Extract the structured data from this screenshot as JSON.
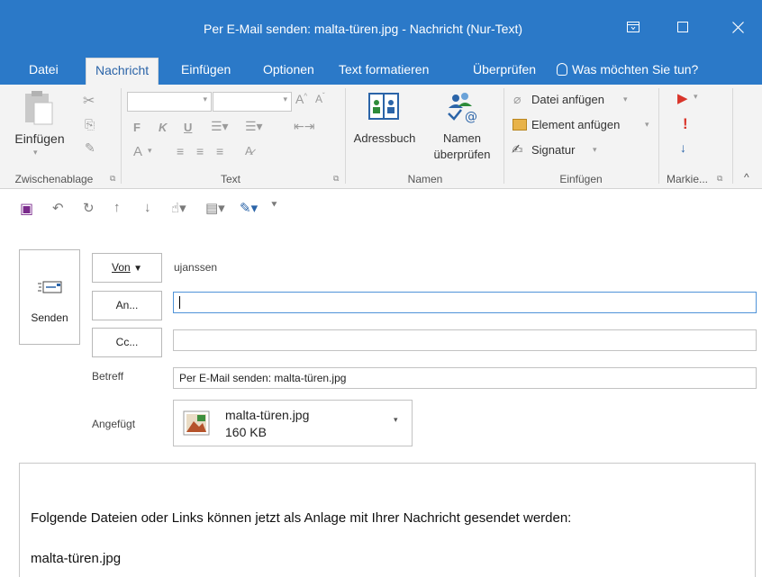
{
  "window": {
    "title": "Per E-Mail senden: malta-türen.jpg  -  Nachricht (Nur-Text)"
  },
  "tabs": [
    {
      "label": "Datei"
    },
    {
      "label": "Nachricht"
    },
    {
      "label": "Einfügen"
    },
    {
      "label": "Optionen"
    },
    {
      "label": "Text formatieren"
    },
    {
      "label": "Überprüfen"
    }
  ],
  "tell_me": "Was möchten Sie tun?",
  "ribbon": {
    "clipboard": {
      "paste_label": "Einfügen",
      "group_label": "Zwischenablage"
    },
    "text": {
      "group_label": "Text",
      "bold": "F",
      "italic": "K",
      "underline": "U",
      "font_color": "A"
    },
    "names": {
      "address_book": "Adressbuch",
      "check_names_line1": "Namen",
      "check_names_line2": "überprüfen",
      "group_label": "Namen"
    },
    "include": {
      "attach_file": "Datei anfügen",
      "attach_item": "Element anfügen",
      "signature": "Signatur",
      "group_label": "Einfügen"
    },
    "tags": {
      "group_label": "Markie..."
    }
  },
  "message": {
    "send_label": "Senden",
    "from_label": "Von",
    "from_value": "ujanssen",
    "to_label": "An...",
    "cc_label": "Cc...",
    "to_value": "",
    "cc_value": "",
    "subject_label": "Betreff",
    "subject_value": "Per E-Mail senden: malta-türen.jpg",
    "attached_label": "Angefügt",
    "attachment": {
      "name": "malta-türen.jpg",
      "size": "160 KB"
    }
  },
  "body": {
    "line1": "Folgende Dateien oder Links können jetzt als Anlage mit Ihrer Nachricht gesendet werden:",
    "line2": "malta-türen.jpg"
  }
}
